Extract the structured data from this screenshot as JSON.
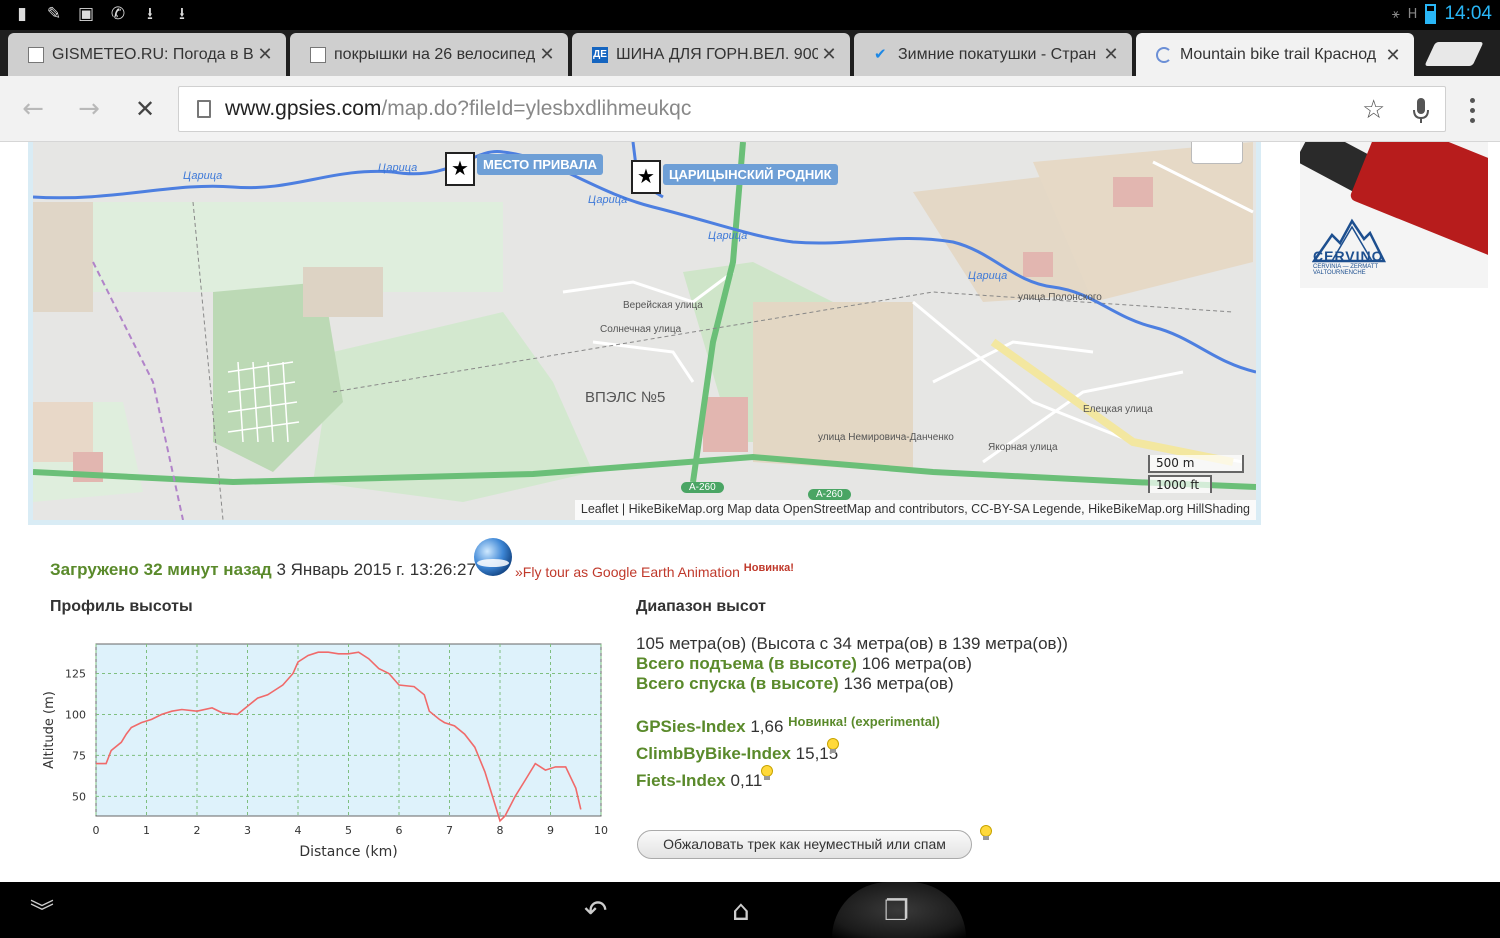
{
  "status": {
    "clock": "14:04",
    "network": "H"
  },
  "tabs": [
    {
      "title": "GISMETEO.RU: Погода в Вол",
      "close": "✕"
    },
    {
      "title": "покрышки на 26 велосипед",
      "close": "✕"
    },
    {
      "title": "ШИНА ДЛЯ ГОРН.ВЕЛ. 900",
      "favicon_text": "ДЕ",
      "close": "✕"
    },
    {
      "title": "Зимние покатушки - Стран",
      "close": "✕"
    },
    {
      "title": "Mountain bike trail Краснод",
      "close": "✕"
    }
  ],
  "toolbar": {
    "url_host": "www.gpsies.com",
    "url_path": "/map.do?fileId=ylesbxdlihmeukqc"
  },
  "map": {
    "pins": [
      {
        "label": "МЕСТО ПРИВАЛА"
      },
      {
        "label": "ЦАРИЦЫНСКИЙ РОДНИК"
      }
    ],
    "labels": {
      "river": "Царица",
      "place": "ВПЭЛС №5",
      "road": "А-260",
      "streets": [
        "Верейская улица",
        "Солнечная улица",
        "Елецкая улица",
        "улица Полонского",
        "улица Немировича-Данченко",
        "Якорная улица"
      ]
    },
    "scale": {
      "metric": "500 m",
      "imperial": "1000 ft"
    },
    "attribution": "Leaflet | HikeBikeMap.org Map data OpenStreetMap and contributors, CC-BY-SA Legende, HikeBikeMap.org HillShading"
  },
  "ad": {
    "brand": "CERVINO",
    "tagline": "CERVINIA — ZERMATT VALTOURNENCHE"
  },
  "info": {
    "uploaded_label": "Загружено 32 минут назад",
    "uploaded_date": "3 Январь 2015 г. 13:26:27",
    "flytour": "»Fly tour as Google Earth Animation",
    "flytour_new": "Новинка!",
    "profile_heading": "Профиль высоты",
    "range_heading": "Диапазон высот",
    "range_text": "105 метра(ов) (Высота с 34 метра(ов) в 139 метра(ов))",
    "ascent_label": "Всего подъема (в высоте)",
    "ascent_value": "106 метра(ов)",
    "descent_label": "Всего спуска (в высоте)",
    "descent_value": "136 метра(ов)",
    "gpsies_label": "GPSies-Index",
    "gpsies_value": "1,66",
    "gpsies_note": "Новинка! (experimental)",
    "climb_label": "ClimbByBike-Index",
    "climb_value": "15,15",
    "fiets_label": "Fiets-Index",
    "fiets_value": "0,11",
    "report_button": "Обжаловать трек как неуместный или спам"
  },
  "chart_data": {
    "type": "line",
    "xlabel": "Distance (km)",
    "ylabel": "Altitude (m)",
    "xlim": [
      0,
      10
    ],
    "ylim": [
      38,
      143
    ],
    "xticks": [
      0,
      1,
      2,
      3,
      4,
      5,
      6,
      7,
      8,
      9,
      10
    ],
    "yticks": [
      50,
      75,
      100,
      125
    ],
    "grid": true,
    "color": "#f06a6a",
    "x": [
      0.0,
      0.2,
      0.3,
      0.5,
      0.6,
      0.7,
      0.9,
      1.1,
      1.3,
      1.5,
      1.7,
      2.0,
      2.3,
      2.5,
      2.8,
      3.0,
      3.2,
      3.4,
      3.5,
      3.7,
      3.9,
      4.0,
      4.2,
      4.4,
      4.6,
      4.8,
      5.0,
      5.2,
      5.4,
      5.6,
      5.8,
      6.0,
      6.3,
      6.5,
      6.6,
      6.8,
      6.9,
      7.1,
      7.3,
      7.5,
      7.7,
      7.9,
      8.0,
      8.1,
      8.3,
      8.5,
      8.7,
      8.9,
      9.1,
      9.3,
      9.5,
      9.6
    ],
    "y": [
      70,
      70,
      78,
      83,
      88,
      92,
      95,
      97,
      100,
      102,
      103,
      102,
      104,
      101,
      100,
      105,
      110,
      112,
      114,
      118,
      125,
      132,
      136,
      138,
      138,
      137,
      137,
      138,
      134,
      128,
      125,
      118,
      117,
      112,
      102,
      97,
      95,
      93,
      88,
      80,
      65,
      45,
      35,
      38,
      50,
      60,
      70,
      66,
      68,
      68,
      55,
      42
    ]
  },
  "navbar": {
    "back": "back",
    "home": "home",
    "recent": "recent-apps"
  }
}
